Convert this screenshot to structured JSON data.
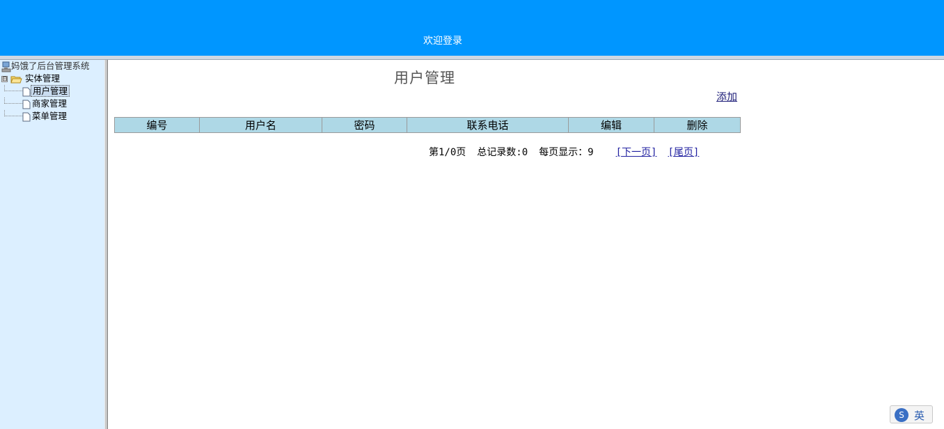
{
  "header": {
    "title": "欢迎登录",
    "bg_color": "#0096ff"
  },
  "sidebar": {
    "root": {
      "label": "妈饿了后台管理系统",
      "icon": "computer-icon"
    },
    "folder": {
      "label": "实体管理",
      "icon": "folder-open-icon",
      "expander": "⊟"
    },
    "items": [
      {
        "label": "用户管理",
        "icon": "document-icon",
        "selected": true
      },
      {
        "label": "商家管理",
        "icon": "document-icon",
        "selected": false
      },
      {
        "label": "菜单管理",
        "icon": "document-icon",
        "selected": false
      }
    ]
  },
  "main": {
    "title": "用户管理",
    "add_label": "添加",
    "table": {
      "columns": [
        "编号",
        "用户名",
        "密码",
        "联系电话",
        "编辑",
        "删除"
      ],
      "rows": []
    },
    "pager": {
      "page_info": "第1/0页",
      "total": "总记录数:0",
      "per_page": "每页显示：9",
      "next": "[下一页]",
      "last": "[尾页]"
    }
  },
  "ime": {
    "lang": "英"
  }
}
